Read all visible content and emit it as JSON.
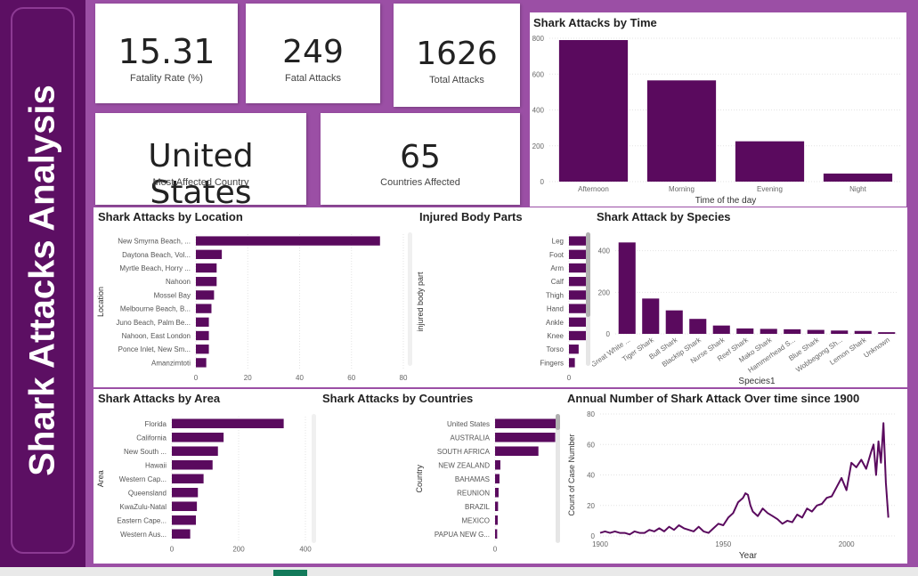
{
  "sidebar": {
    "title": "Shark Attacks Analysis"
  },
  "kpis": {
    "fatality_rate": {
      "value": "15.31",
      "label": "Fatality Rate (%)"
    },
    "fatal_attacks": {
      "value": "249",
      "label": "Fatal Attacks"
    },
    "total_attacks": {
      "value": "1626",
      "label": "Total Attacks"
    },
    "most_affected_country": {
      "value": "United States",
      "label": "Most Affected Country"
    },
    "countries_affected": {
      "value": "65",
      "label": "Countries Affected"
    }
  },
  "colors": {
    "bar": "#5a0a5e",
    "accent": "#9b4fa5",
    "sidebar": "#5c0f63"
  },
  "chart_data": [
    {
      "id": "time",
      "type": "bar",
      "title": "Shark Attacks by Time",
      "xlabel": "Time of the day",
      "ylabel": "",
      "categories": [
        "Afternoon",
        "Morning",
        "Evening",
        "Night"
      ],
      "values": [
        790,
        565,
        225,
        45
      ],
      "ylim": [
        0,
        800
      ],
      "yticks": [
        "800",
        "600",
        "400",
        "200",
        "0"
      ],
      "grid": true
    },
    {
      "id": "location",
      "type": "bar",
      "orientation": "horizontal",
      "title": "Shark Attacks by Location",
      "xlabel": "",
      "ylabel": "Location",
      "categories": [
        "New Smyrna Beach, ...",
        "Daytona Beach, Vol...",
        "Myrtle Beach, Horry ...",
        "Nahoon",
        "Mossel Bay",
        "Melbourne Beach, B...",
        "Juno Beach, Palm Be...",
        "Nahoon, East London",
        "Ponce Inlet, New Sm...",
        "Amanzimtoti"
      ],
      "values": [
        71,
        10,
        8,
        8,
        7,
        6,
        5,
        5,
        5,
        4
      ],
      "xlim": [
        0,
        80
      ],
      "xticks": [
        "0",
        "20",
        "40",
        "60",
        "80"
      ],
      "grid": true
    },
    {
      "id": "body",
      "type": "bar",
      "orientation": "horizontal",
      "title": "Injured Body Parts",
      "xlabel": "",
      "ylabel": "injured body part",
      "categories": [
        "Leg",
        "Foot",
        "Arm",
        "Calf",
        "Thigh",
        "Hand",
        "Ankle",
        "Knee",
        "Torso",
        "Fingers"
      ],
      "values": [
        262,
        198,
        160,
        115,
        103,
        95,
        70,
        62,
        28,
        17
      ],
      "xlim": [
        0,
        265
      ],
      "xticks": [
        "0",
        "200"
      ],
      "xtick_values": [
        0,
        200
      ],
      "grid": true
    },
    {
      "id": "species",
      "type": "bar",
      "title": "Shark Attack by Species",
      "xlabel": "Species1",
      "ylabel": "",
      "categories": [
        "Great White ...",
        "Tiger Shark",
        "Bull Shark",
        "Blacktip Shark",
        "Nurse Shark",
        "Reef Shark",
        "Mako Shark",
        "Hammerhead S...",
        "Blue Shark",
        "Wobbegong Sh...",
        "Lemon Shark",
        "Unknown"
      ],
      "values": [
        440,
        170,
        113,
        72,
        40,
        26,
        24,
        22,
        19,
        16,
        14,
        8
      ],
      "ylim": [
        0,
        480
      ],
      "yticks": [
        "400",
        "200",
        "0"
      ],
      "ytick_values": [
        400,
        200,
        0
      ],
      "grid": true
    },
    {
      "id": "area",
      "type": "bar",
      "orientation": "horizontal",
      "title": "Shark Attacks by Area",
      "xlabel": "",
      "ylabel": "Area",
      "categories": [
        "Florida",
        "California",
        "New South ...",
        "Hawaii",
        "Western Cap...",
        "Queensland",
        "KwaZulu-Natal",
        "Eastern Cape...",
        "Western Aus..."
      ],
      "values": [
        335,
        155,
        138,
        122,
        95,
        78,
        75,
        72,
        55
      ],
      "xlim": [
        0,
        400
      ],
      "xticks": [
        "0",
        "200",
        "400"
      ],
      "grid": true
    },
    {
      "id": "countries",
      "type": "bar",
      "orientation": "horizontal",
      "title": "Shark Attacks by Countries",
      "xlabel": "",
      "ylabel": "Country",
      "categories": [
        "United States",
        "AUSTRALIA",
        "SOUTH AFRICA",
        "NEW ZEALAND",
        "BAHAMAS",
        "REUNION",
        "BRAZIL",
        "MEXICO",
        "PAPUA NEW G..."
      ],
      "values": [
        790,
        340,
        245,
        30,
        25,
        20,
        17,
        15,
        12
      ],
      "xlim": [
        0,
        800
      ],
      "xticks": [
        "0",
        "500"
      ],
      "xtick_values": [
        0,
        500
      ],
      "grid": true
    },
    {
      "id": "annual",
      "type": "line",
      "title": "Annual Number of Shark Attack Over time since 1900",
      "xlabel": "Year",
      "ylabel": "Count of Case Number",
      "xlim": [
        1900,
        2020
      ],
      "ylim": [
        0,
        80
      ],
      "xticks": [
        "1900",
        "1950",
        "2000"
      ],
      "xtick_values": [
        1900,
        1950,
        2000
      ],
      "yticks": [
        "80",
        "60",
        "40",
        "20",
        "0"
      ],
      "x": [
        1900,
        1902,
        1904,
        1906,
        1908,
        1910,
        1912,
        1914,
        1916,
        1918,
        1920,
        1922,
        1924,
        1926,
        1928,
        1930,
        1932,
        1934,
        1936,
        1938,
        1940,
        1942,
        1944,
        1946,
        1948,
        1950,
        1952,
        1954,
        1956,
        1958,
        1959,
        1960,
        1961,
        1962,
        1964,
        1966,
        1968,
        1970,
        1972,
        1974,
        1976,
        1978,
        1980,
        1982,
        1984,
        1986,
        1988,
        1990,
        1992,
        1994,
        1996,
        1998,
        2000,
        2002,
        2004,
        2006,
        2008,
        2010,
        2011,
        2012,
        2013,
        2014,
        2015,
        2016,
        2017
      ],
      "y": [
        2,
        3,
        2,
        3,
        2,
        2,
        1,
        3,
        2,
        2,
        4,
        3,
        5,
        3,
        6,
        4,
        7,
        5,
        4,
        3,
        6,
        3,
        2,
        5,
        8,
        7,
        12,
        15,
        22,
        25,
        28,
        27,
        20,
        16,
        13,
        18,
        15,
        13,
        11,
        8,
        10,
        9,
        14,
        12,
        18,
        16,
        20,
        21,
        25,
        26,
        32,
        38,
        30,
        48,
        45,
        50,
        44,
        55,
        60,
        40,
        62,
        48,
        74,
        35,
        12
      ],
      "grid": true
    }
  ]
}
